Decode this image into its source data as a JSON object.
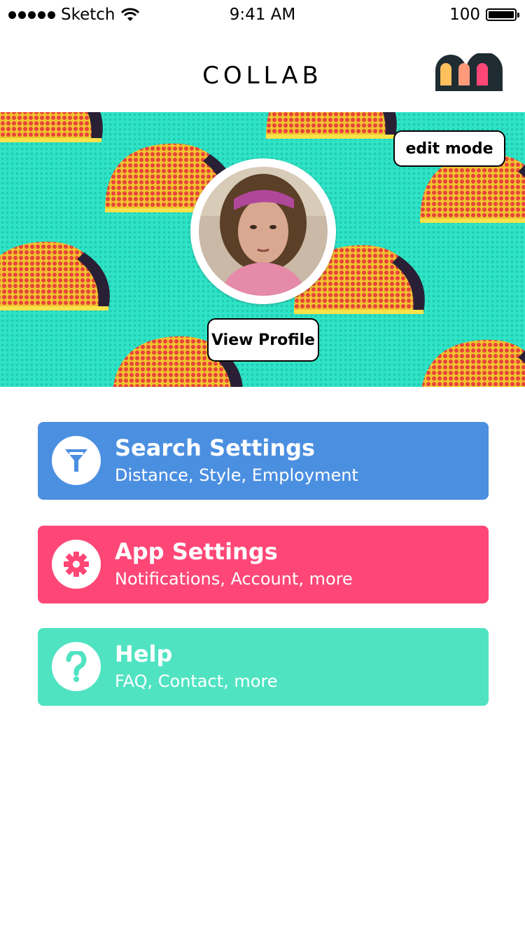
{
  "status_bar": {
    "carrier": "Sketch",
    "time": "9:41 AM",
    "battery": "100"
  },
  "nav": {
    "title": "COLLAB",
    "logo_colors": [
      "#ffc15e",
      "#ff9a7a",
      "#ff4777"
    ]
  },
  "hero": {
    "edit_label": "edit mode",
    "view_profile_label": "View Profile",
    "background_color": "#2fe3c6"
  },
  "menu": {
    "search": {
      "title": "Search Settings",
      "subtitle": "Distance, Style, Employment",
      "icon": "filter-icon",
      "color": "#4b8fe1"
    },
    "app": {
      "title": "App Settings",
      "subtitle": "Notifications, Account, more",
      "icon": "gear-icon",
      "color": "#ff4777"
    },
    "help": {
      "title": "Help",
      "subtitle": "FAQ, Contact, more",
      "icon": "question-icon",
      "color": "#50e3c2"
    }
  }
}
